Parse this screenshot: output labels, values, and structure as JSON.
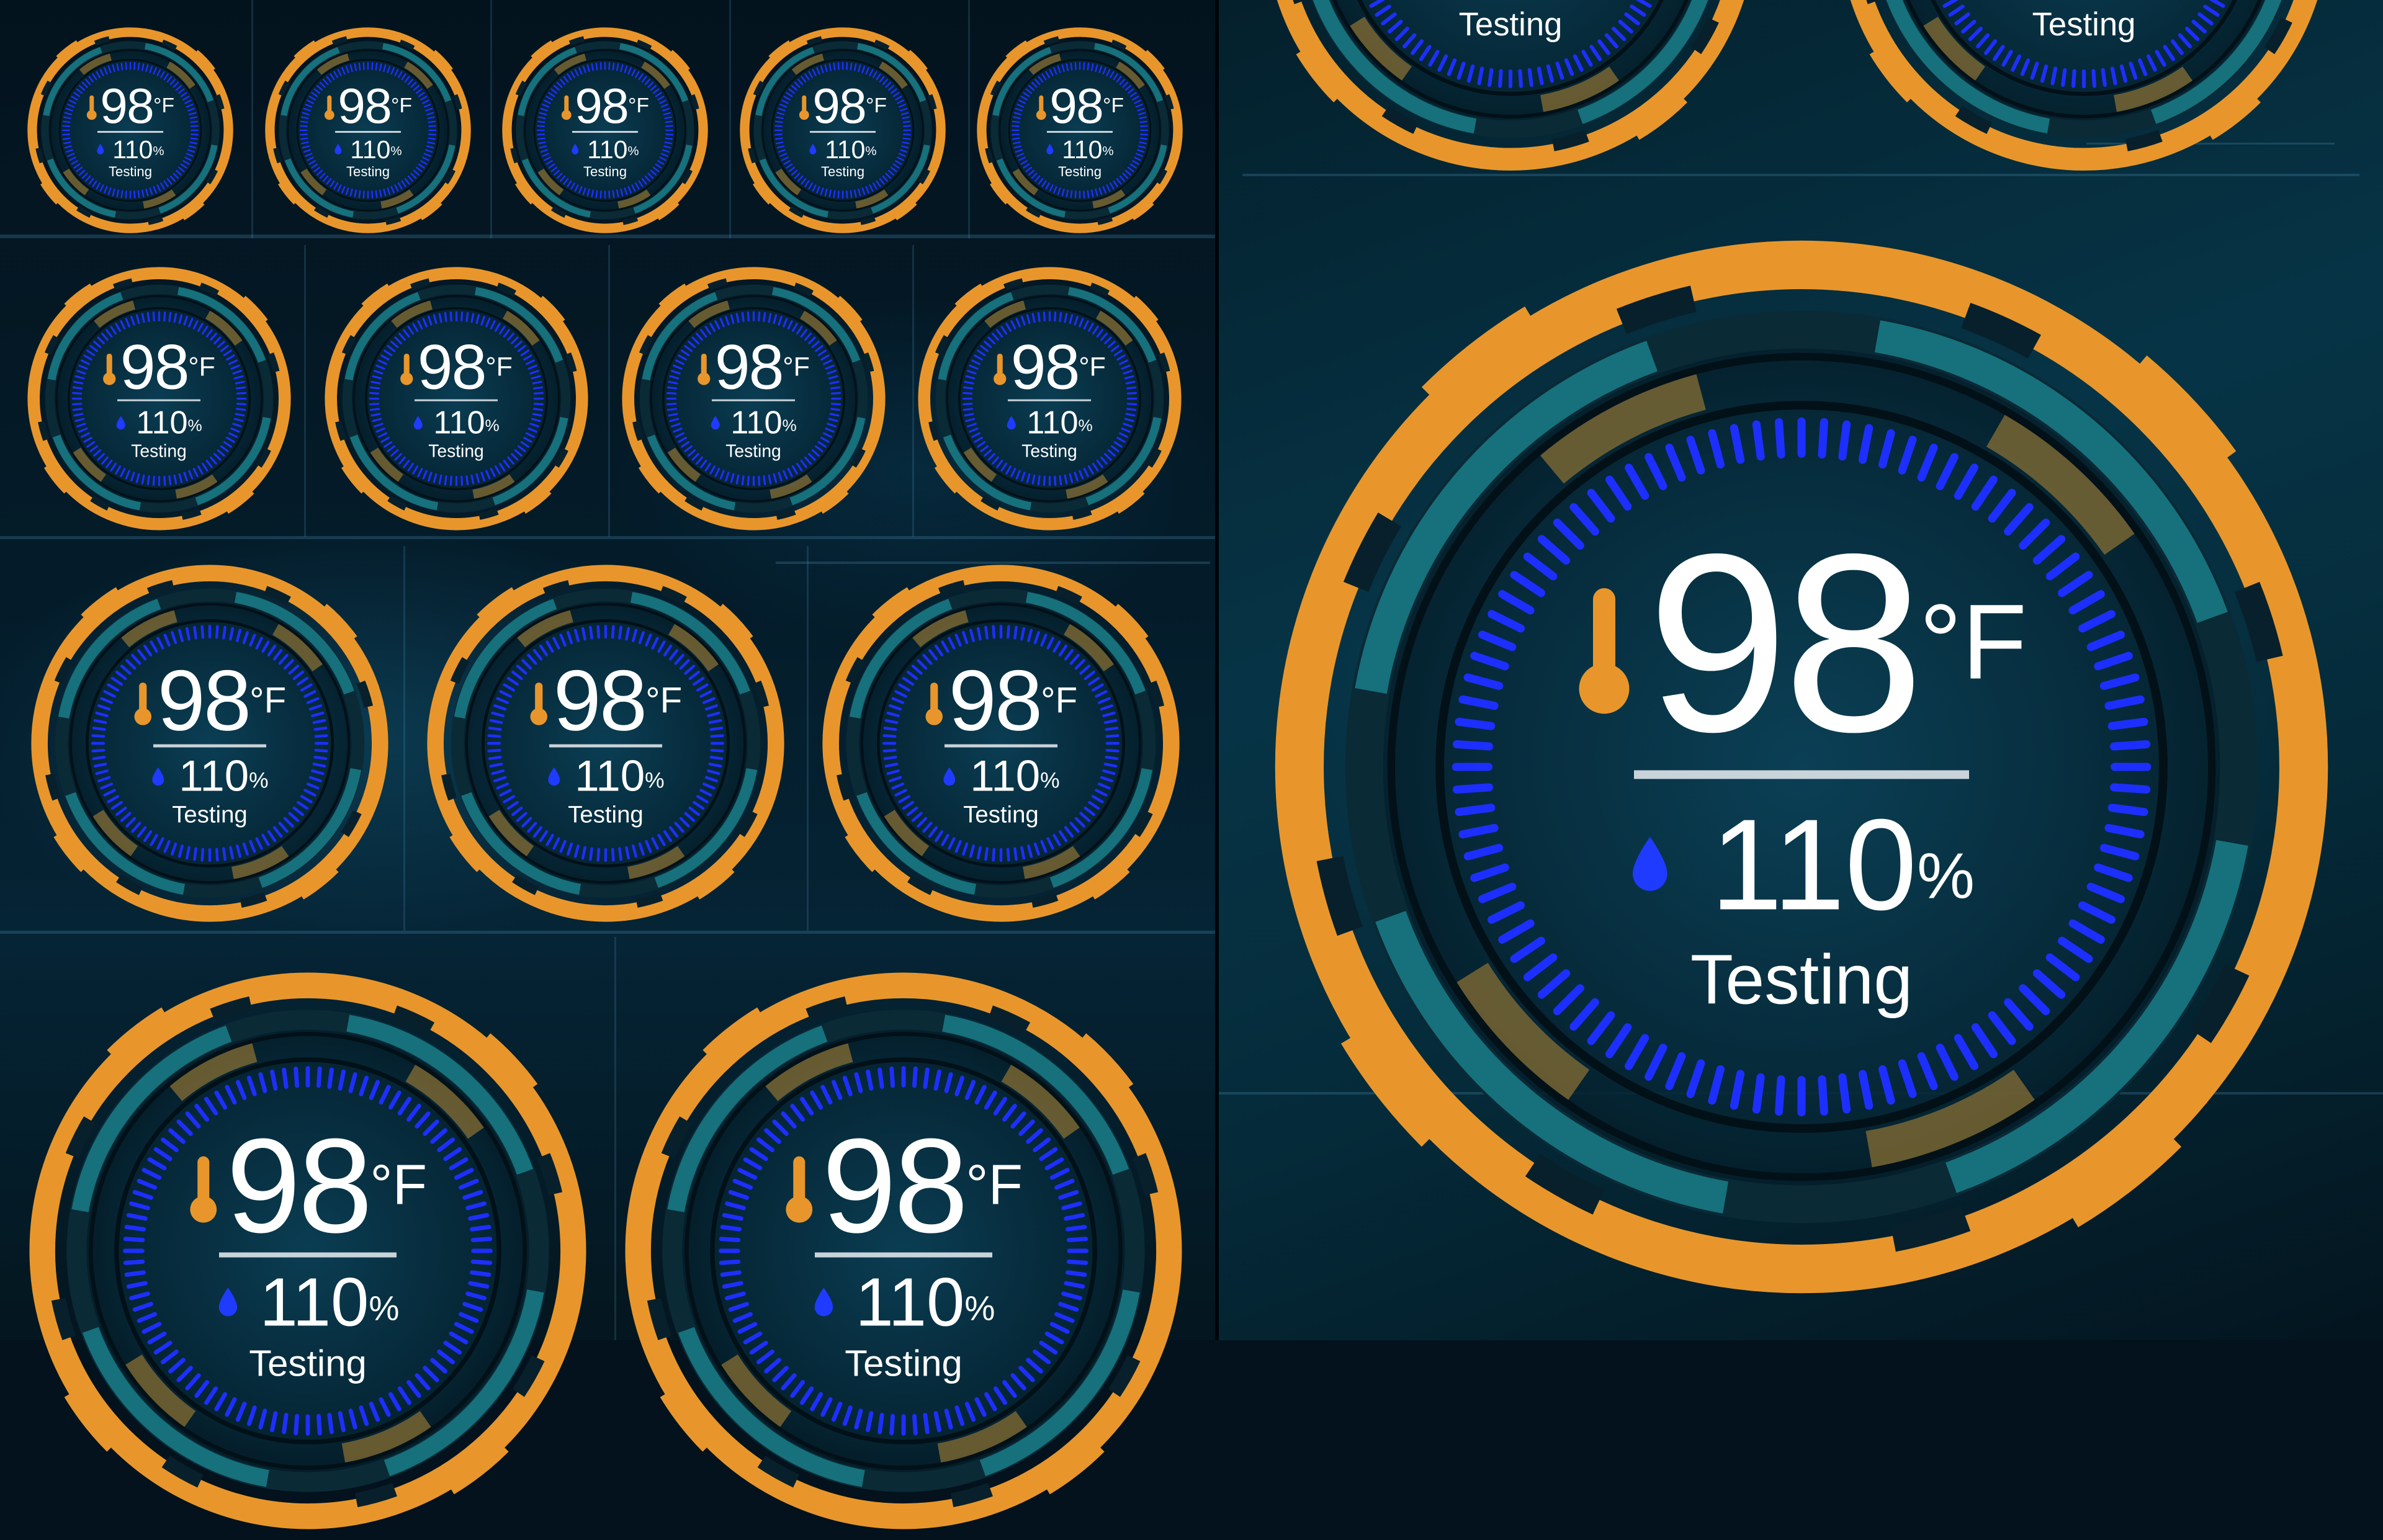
{
  "reading": {
    "temperature": "98",
    "temperature_unit": "°F",
    "humidity": "110",
    "humidity_unit": "%",
    "label": "Testing"
  },
  "icons": {
    "temperature": "thermometer-icon",
    "humidity": "humidity-drop-icon"
  },
  "colors": {
    "outer_ring": "#e8962b",
    "tick_ring": "#1d2fff",
    "teal_arc": "#1b8a94",
    "dark_ring": "#0a2a36",
    "text": "#ffffff",
    "drop": "#1f3bff",
    "background": "#052435"
  }
}
